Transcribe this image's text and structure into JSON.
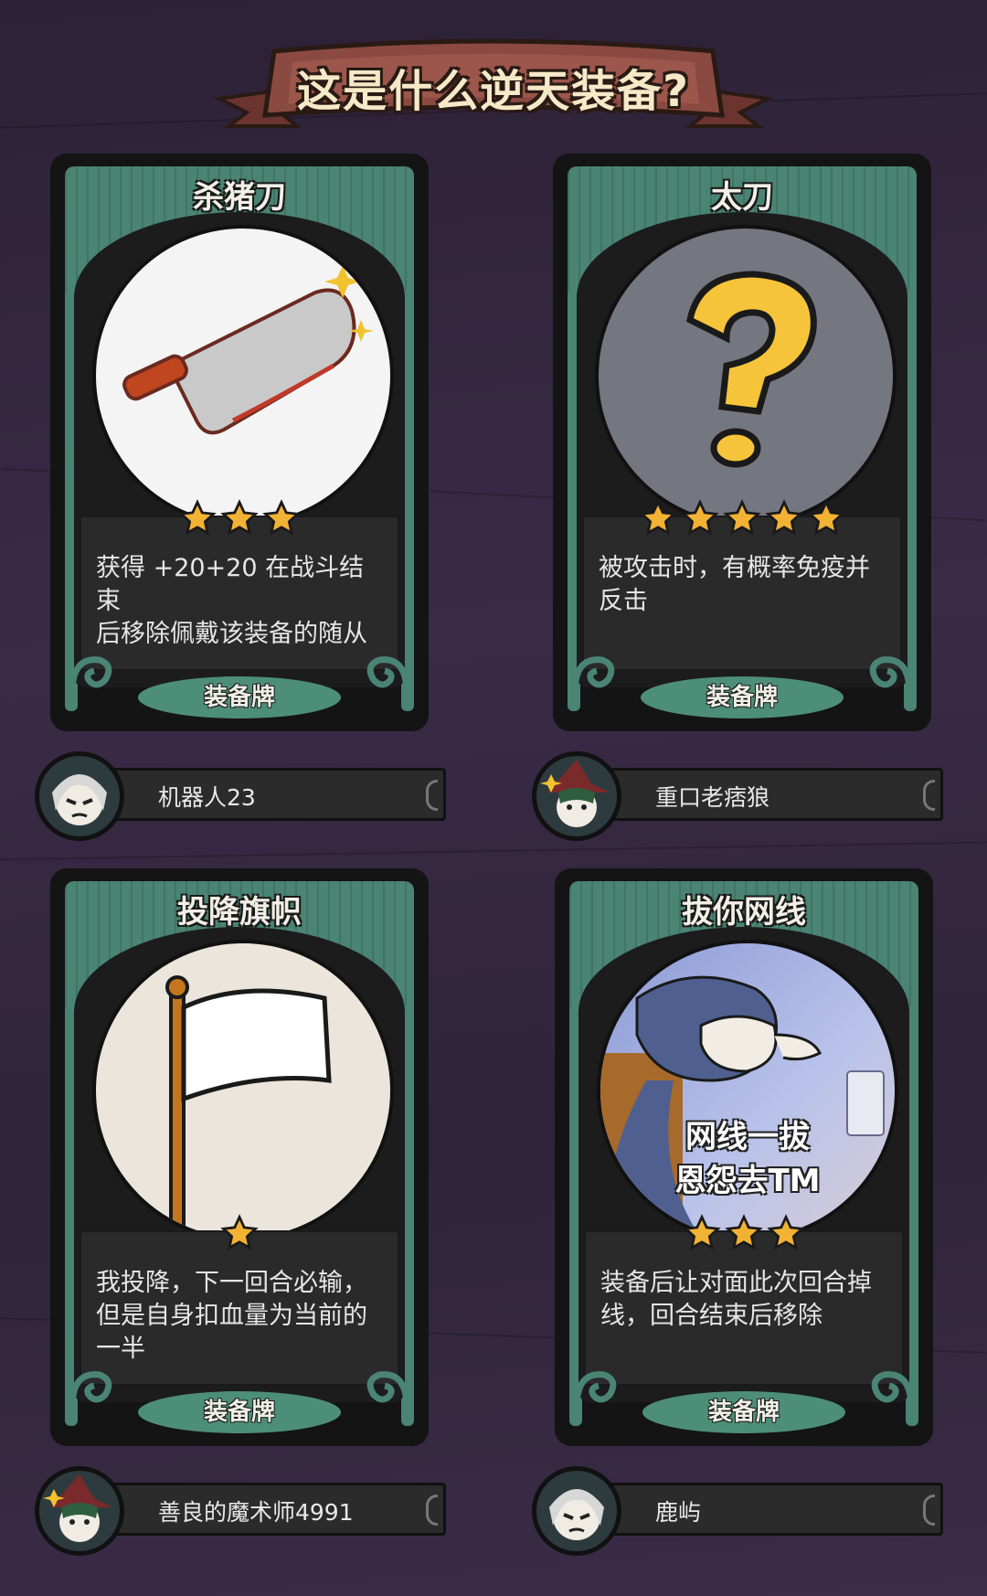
{
  "header": {
    "title": "这是什么逆天装备?"
  },
  "cards": [
    {
      "name": "杀猪刀",
      "stars": 3,
      "desc_line1": "获得 +20+20 在战斗结束",
      "desc_line2": "后移除佩戴该装备的随从",
      "desc_line3": "",
      "type_label": "装备牌",
      "art_icon": "cleaver-icon",
      "user": "机器人23",
      "avatar_icon": "silver-hair-avatar-icon"
    },
    {
      "name": "太刀",
      "stars": 5,
      "desc_line1": "被攻击时，有概率免疫并",
      "desc_line2": "反击",
      "desc_line3": "",
      "type_label": "装备牌",
      "art_icon": "question-mark-icon",
      "user": "重口老痞狼",
      "avatar_icon": "witch-hat-avatar-icon"
    },
    {
      "name": "投降旗帜",
      "stars": 1,
      "desc_line1": "我投降，下一回合必输，",
      "desc_line2": "但是自身扣血量为当前的",
      "desc_line3": "一半",
      "type_label": "装备牌",
      "art_icon": "white-flag-icon",
      "user": "善良的魔术师4991",
      "avatar_icon": "witch-hat-avatar-icon"
    },
    {
      "name": "拔你网线",
      "stars": 3,
      "desc_line1": "装备后让对面此次回合掉",
      "desc_line2": "线，回合结束后移除",
      "desc_line3": "",
      "type_label": "装备牌",
      "art_icon": "cartoon-cat-meme-icon",
      "art_caption1": "网线一拔",
      "art_caption2": "恩怨去TM",
      "user": "鹿屿",
      "avatar_icon": "silver-hair-avatar-icon"
    }
  ],
  "colors": {
    "background": "#33263f",
    "card_green": "#4a8473",
    "star_gold": "#f2b233",
    "banner_red": "#7a3f38"
  }
}
